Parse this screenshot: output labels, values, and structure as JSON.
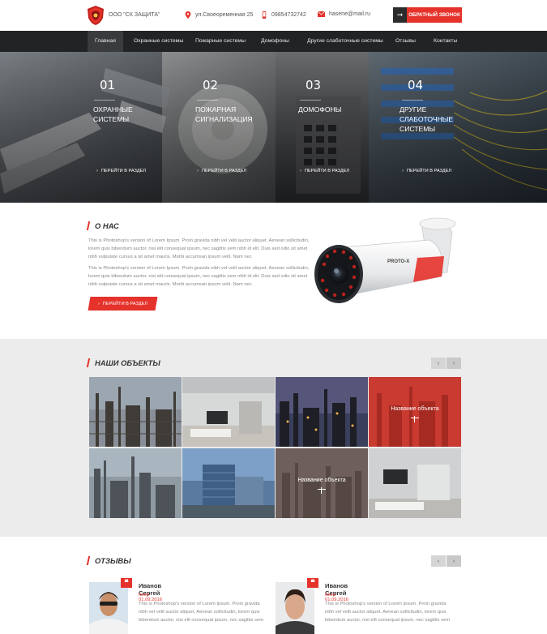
{
  "header": {
    "company": "ООО \"СК ЗАЩИТА\"",
    "address": "ул.Своеоременная 25",
    "phone": "09854732742",
    "email": "hasene@mail.ru",
    "callback_label": "ОБРАТНЫЙ ЗВОНОК",
    "icons": [
      "shield-logo",
      "location-pin-icon",
      "phone-icon",
      "mail-icon",
      "arrow-right-icon"
    ]
  },
  "nav": {
    "items": [
      "Главная",
      "Охранные системы",
      "Пожарные системы",
      "Домофоны",
      "Другие слаботочные системы",
      "Отзывы",
      "Контакты"
    ],
    "active": "Главная"
  },
  "hero": {
    "panels": [
      {
        "num": "01",
        "title_l1": "ОХРАННЫЕ",
        "title_l2": "СИСТЕМЫ",
        "title_l3": "",
        "link": "ПЕРЕЙТИ В РАЗДЕЛ"
      },
      {
        "num": "02",
        "title_l1": "ПОЖАРНАЯ",
        "title_l2": "СИГНАЛИЗАЦИЯ",
        "title_l3": "",
        "link": "ПЕРЕЙТИ В РАЗДЕЛ"
      },
      {
        "num": "03",
        "title_l1": "ДОМОФОНЫ",
        "title_l2": "",
        "title_l3": "",
        "link": "ПЕРЕЙТИ В РАЗДЕЛ"
      },
      {
        "num": "04",
        "title_l1": "ДРУГИЕ",
        "title_l2": "СЛАБОТОЧНЫЕ",
        "title_l3": "СИСТЕМЫ",
        "link": "ПЕРЕЙТИ В РАЗДЕЛ"
      }
    ]
  },
  "about": {
    "title": "О НАС",
    "p1": "This is Photoshop's version of Lorem Ipsum. Proin gravida nibh vel velit auctor aliquet. Aenean sollicitudin, lorem quis bibendum auctor, nisi elit consequat ipsum, nec sagittis sem nibh id elit. Duis sed odio sit amet nibh vulputate cursus a sit amet mauris. Morbi accumsan ipsum velit. Nam nec",
    "p2": "This is Photoshop's version of Lorem Ipsum. Proin gravida nibh vel velit auctor aliquet. Aenean sollicitudin, lorem quis bibendum auctor, nisi elit consequat ipsum, nec sagittis sem nibh id elit. Duis sed odio sit amet nibh vulputate cursus a sit amet mauris. Morbi accumsan ipsum velit. Nam nec",
    "button": "ПЕРЕЙТИ В РАЗДЕЛ",
    "camera_brand": "PROTO-X"
  },
  "objects": {
    "title": "НАШИ ОБЪЕКТЫ",
    "prev": "‹",
    "next": "›",
    "overlay_name_1": "Название объекта",
    "overlay_name_2": "Название объекта"
  },
  "reviews": {
    "title": "ОТЗЫВЫ",
    "prev": "‹",
    "next": "›",
    "items": [
      {
        "name": "Иванов Сергей",
        "date": "Киев 01.09.2016",
        "text": "This is Photoshop's version of Lorem Ipsum. Proin gravida nibh vel velit auctor aliquet. Aenean sollicitudin, lorem quis bibendum auctor, nisi elit consequat ipsum, nec sagittis sem"
      },
      {
        "name": "Иванов Сергей",
        "date": "Киев 01.09.2016",
        "text": "This is Photoshop's version of Lorem Ipsum. Proin gravida nibh vel velit auctor aliquet. Aenean sollicitudin, lorem quis bibendum auctor, nisi elit consequat ipsum, nec sagittis sem"
      }
    ],
    "quote_mark": "❝"
  },
  "colors": {
    "accent": "#e5322b",
    "nav_bg": "#222324",
    "objects_bg": "#ececec"
  }
}
